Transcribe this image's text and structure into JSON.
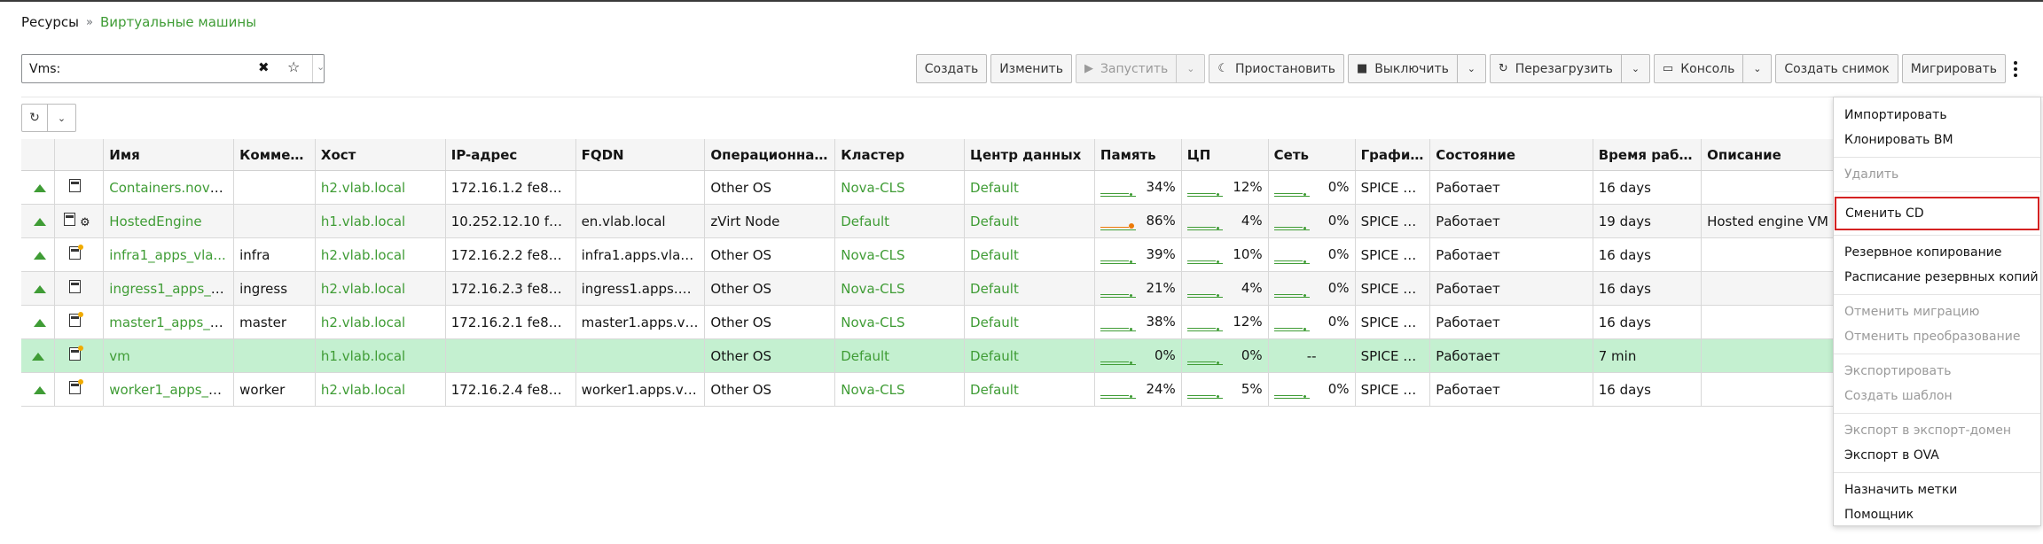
{
  "breadcrumb": {
    "root": "Ресурсы",
    "separator": "»",
    "current": "Виртуальные машины"
  },
  "search": {
    "value": "Vms:"
  },
  "toolbar": {
    "create": "Создать",
    "edit": "Изменить",
    "run": "Запустить",
    "suspend": "Приостановить",
    "shutdown": "Выключить",
    "reboot": "Перезагрузить",
    "console": "Консоль",
    "snapshot": "Создать снимок",
    "migrate": "Мигрировать"
  },
  "table": {
    "columns": [
      "",
      "",
      "Имя",
      "Коммен...",
      "Хост",
      "IP-адрес",
      "FQDN",
      "Операционная...",
      "Кластер",
      "Центр данных",
      "Память",
      "ЦП",
      "Сеть",
      "Графика",
      "Состояние",
      "Время рабо...",
      "Описание"
    ],
    "rows": [
      {
        "name": "Containers.nova...",
        "comment": "",
        "host": "h2.vlab.local",
        "ip": "172.16.1.2 fe80::...",
        "fqdn": "",
        "os": "Other OS",
        "cluster": "Nova-CLS",
        "dc": "Default",
        "mem": "34%",
        "cpu": "12%",
        "net": "0%",
        "graphics": "SPICE + ...",
        "state": "Работает",
        "uptime": "16 days",
        "desc": ""
      },
      {
        "name": "HostedEngine",
        "comment": "",
        "host": "h1.vlab.local",
        "ip": "10.252.12.10 fe8...",
        "fqdn": "en.vlab.local",
        "os": "zVirt Node",
        "cluster": "Default",
        "dc": "Default",
        "mem": "86%",
        "cpu": "4%",
        "net": "0%",
        "graphics": "SPICE + ...",
        "state": "Работает",
        "uptime": "19 days",
        "desc": "Hosted engine VM"
      },
      {
        "name": "infra1_apps_vla...",
        "comment": "infra",
        "host": "h2.vlab.local",
        "ip": "172.16.2.2 fe80::...",
        "fqdn": "infra1.apps.vlab....",
        "os": "Other OS",
        "cluster": "Nova-CLS",
        "dc": "Default",
        "mem": "39%",
        "cpu": "10%",
        "net": "0%",
        "graphics": "SPICE + ...",
        "state": "Работает",
        "uptime": "16 days",
        "desc": ""
      },
      {
        "name": "ingress1_apps_v...",
        "comment": "ingress",
        "host": "h2.vlab.local",
        "ip": "172.16.2.3 fe80::...",
        "fqdn": "ingress1.apps.vl...",
        "os": "Other OS",
        "cluster": "Nova-CLS",
        "dc": "Default",
        "mem": "21%",
        "cpu": "4%",
        "net": "0%",
        "graphics": "SPICE + ...",
        "state": "Работает",
        "uptime": "16 days",
        "desc": ""
      },
      {
        "name": "master1_apps_v...",
        "comment": "master",
        "host": "h2.vlab.local",
        "ip": "172.16.2.1 fe80::...",
        "fqdn": "master1.apps.vl...",
        "os": "Other OS",
        "cluster": "Nova-CLS",
        "dc": "Default",
        "mem": "38%",
        "cpu": "12%",
        "net": "0%",
        "graphics": "SPICE + ...",
        "state": "Работает",
        "uptime": "16 days",
        "desc": ""
      },
      {
        "name": "vm",
        "comment": "",
        "host": "h1.vlab.local",
        "ip": "",
        "fqdn": "",
        "os": "Other OS",
        "cluster": "Default",
        "dc": "Default",
        "mem": "0%",
        "cpu": "0%",
        "net": "--",
        "graphics": "SPICE + ...",
        "state": "Работает",
        "uptime": "7 min",
        "desc": ""
      },
      {
        "name": "worker1_apps_vl...",
        "comment": "worker",
        "host": "h2.vlab.local",
        "ip": "172.16.2.4 fe80::...",
        "fqdn": "worker1.apps.vla...",
        "os": "Other OS",
        "cluster": "Nova-CLS",
        "dc": "Default",
        "mem": "24%",
        "cpu": "5%",
        "net": "0%",
        "graphics": "SPICE + ...",
        "state": "Работает",
        "uptime": "16 days",
        "desc": ""
      }
    ]
  },
  "menu": {
    "import": "Импортировать",
    "clone": "Клонировать ВМ",
    "delete": "Удалить",
    "change_cd": "Сменить CD",
    "backup": "Резервное копирование",
    "backup_schedule": "Расписание резервных копий",
    "cancel_migration": "Отменить миграцию",
    "cancel_conversion": "Отменить преобразование",
    "export": "Экспортировать",
    "create_template": "Создать шаблон",
    "export_domain": "Экспорт в экспорт-домен",
    "export_ova": "Экспорт в OVA",
    "assign_tags": "Назначить метки",
    "assistant": "Помощник"
  },
  "colors": {
    "accent": "#3f9c35",
    "highlight": "#d42222",
    "selected_row": "#c4f0d0",
    "warning": "#ec7a08"
  },
  "icons": [
    "refresh-icon",
    "chevron-down-icon",
    "bookmark-star-icon",
    "clear-icon",
    "play-icon",
    "moon-icon",
    "stop-icon",
    "refresh-icon",
    "monitor-icon",
    "kebab-icon",
    "vm-status-up-icon",
    "vm-type-icon"
  ]
}
